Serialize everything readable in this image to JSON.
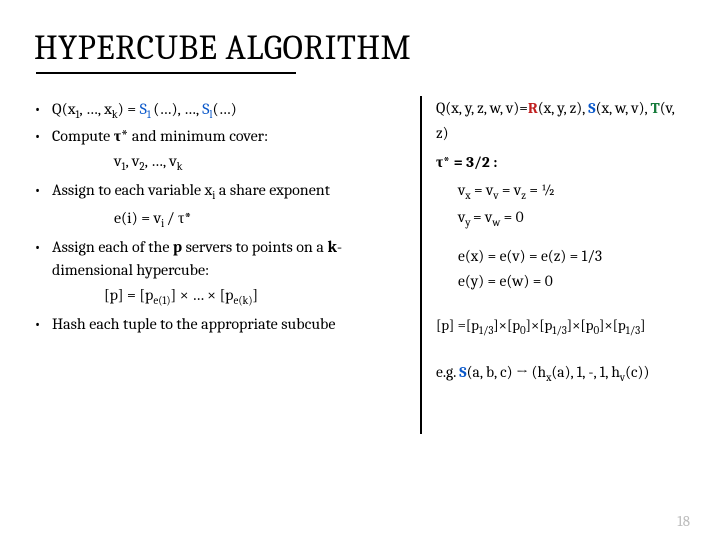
{
  "title": {
    "part1": "H",
    "part2": "YPER",
    "part3": "C",
    "part4": "UBE ",
    "part5": "A",
    "part6": "LGORITHM"
  },
  "left": {
    "b1_pre": "Q(x",
    "b1_sub1": "1",
    "b1_mid": ", …, x",
    "b1_sub2": "k",
    "b1_after": ") = ",
    "b1_s1": "S",
    "b1_s1sub": "1 ",
    "b1_paren": "(…), …, ",
    "b1_sl": "S",
    "b1_slsub": "l",
    "b1_end": "(…)",
    "b2": "Compute ",
    "b2_tau": "τ*",
    "b2_end": " and minimum cover:",
    "ind1_pre": "v",
    "ind1_s1": "1",
    "ind1_m": ", v",
    "ind1_s2": "2",
    "ind1_e": ", …, v",
    "ind1_sk": "k",
    "b3": "Assign to each variable x",
    "b3_sub": "i",
    "b3_end": " a share exponent",
    "ind2": "e(i) = v",
    "ind2_sub": "i ",
    "ind2_end": "/ τ*",
    "b4": "Assign each of the ",
    "b4_p": "p",
    "b4_mid": " servers to points on a ",
    "b4_k": "k",
    "b4_end": "-dimensional hypercube:",
    "ind3": "[p] = [p",
    "ind3_e1": "e(1)",
    "ind3_mid": "] × … × [p",
    "ind3_e2": "e(k)",
    "ind3_end": "]",
    "b5": "Hash each tuple to the appropriate subcube"
  },
  "right": {
    "l1_q": "Q(x, y, z, w, v)=",
    "l1_r": "R",
    "l1_rargs": "(x, y, z), ",
    "l1_s": "S",
    "l1_sargs": "(x, w, v), ",
    "l1_t": "T",
    "l1_targs": "(v, z)",
    "l2": "τ* = 3/2 :",
    "l3": "v",
    "l3x": "x",
    "l3a": " = v",
    "l3v": "v",
    "l3b": " = v",
    "l3z": "z",
    "l3end": " = ½",
    "l4": "v",
    "l4y": "y ",
    "l4a": " = v",
    "l4w": "w",
    "l4end": " = 0",
    "l5": "e(x) = e(v) = e(z) = 1/3",
    "l6": "e(y) = e(w) = 0",
    "l7": "[p] =[p",
    "l7a": "1/3",
    "l7b": "]×[p",
    "l7c": "0",
    "l7d": "]×[p",
    "l7e": "1/3",
    "l7f": "]×[p",
    "l7g": "0",
    "l7h": "]×[p",
    "l7i": "1/3",
    "l7j": "]",
    "l8_pre": "e.g. ",
    "l8_s": "S",
    "l8_args": "(a, b, c) ",
    "l8_arrow": "→",
    "l8_end": " (h",
    "l8_hx": "x",
    "l8_mid": "(a), 1, -, 1, h",
    "l8_hv": "v",
    "l8_tail": "(c))"
  },
  "page": "18"
}
